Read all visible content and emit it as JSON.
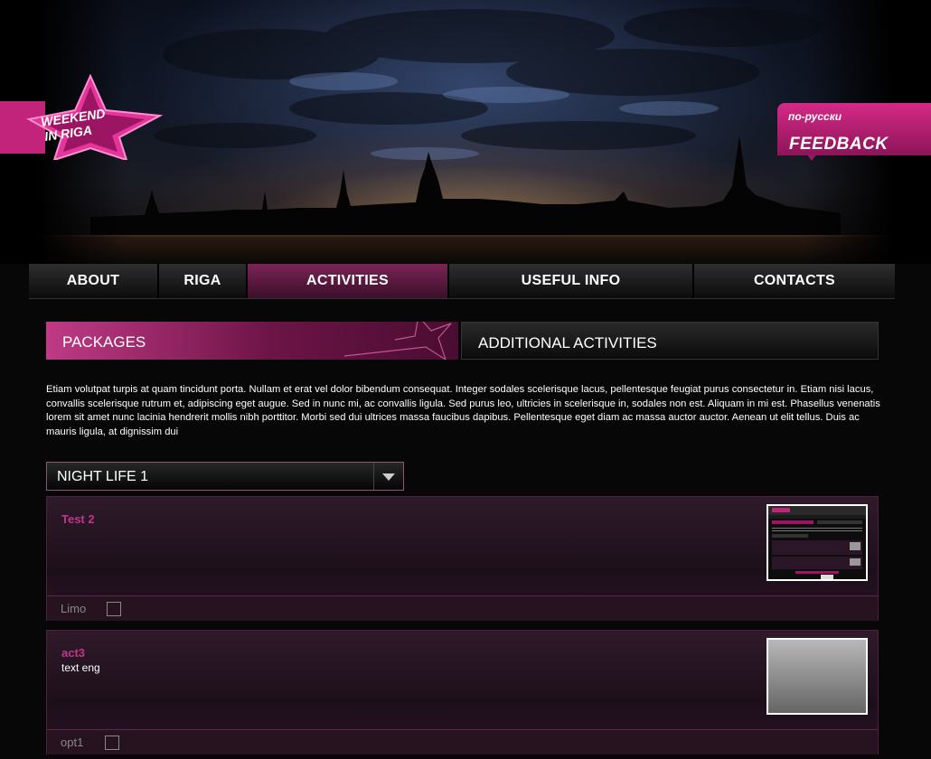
{
  "brand": {
    "logo_line1": "WEEKEND",
    "logo_line2": "IN RIGA"
  },
  "header": {
    "lang_link": "по-русски",
    "feedback": "FEEDBACK"
  },
  "nav": [
    {
      "label": "ABOUT",
      "active": false
    },
    {
      "label": "RIGA",
      "active": false
    },
    {
      "label": "ACTIVITIES",
      "active": true
    },
    {
      "label": "USEFUL INFO",
      "active": false
    },
    {
      "label": "CONTACTS",
      "active": false
    }
  ],
  "tabs": {
    "packages": "PACKAGES",
    "additional": "ADDITIONAL ACTIVITIES"
  },
  "description": "Etiam volutpat turpis at quam tincidunt porta. Nullam et erat vel dolor bibendum consequat. Integer sodales scelerisque lacus, pellentesque feugiat purus consectetur in. Etiam nisi lacus, convallis scelerisque rutrum et, adipiscing eget augue. Sed in nunc mi, ac convallis ligula. Sed purus leo, ultricies in scelerisque in, sodales non est. Aliquam in mi est. Phasellus venenatis lorem sit amet nunc lacinia hendrerit mollis nibh porttitor. Morbi sed dui ultrices massa faucibus dapibus. Pellentesque eget diam ac massa auctor auctor. Aenean ut elit tellus. Duis ac mauris ligula, at dignissim dui",
  "select": {
    "value": "NIGHT LIFE 1"
  },
  "activities": [
    {
      "title": "Test 2",
      "text": "",
      "option": "Limo",
      "checked": false
    },
    {
      "title": "act3",
      "text": "text eng",
      "option": "opt1",
      "checked": false
    }
  ],
  "colors": {
    "accent": "#c0378a",
    "brand_pink": "#d42a87",
    "background": "#070707"
  }
}
